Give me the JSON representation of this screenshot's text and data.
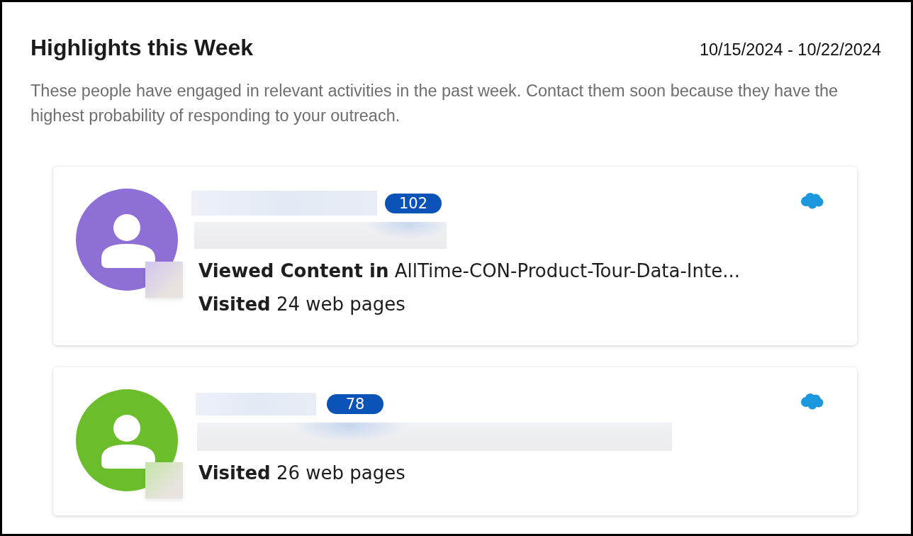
{
  "header": {
    "title": "Highlights this Week",
    "date_range": "10/15/2024 - 10/22/2024"
  },
  "description": "These people have engaged in relevant activities in the past week. Contact them soon because they have the highest probability of responding to your outreach.",
  "people": [
    {
      "color": "#8d6fd5",
      "score": "102",
      "activities": [
        "**Viewed Content in** AllTime-CON-Product-Tour-Data-Inte...",
        "**Visited** 24 web pages"
      ]
    },
    {
      "color": "#6bbd2b",
      "score": "78",
      "activities": [
        "**Visited** 26 web pages"
      ]
    }
  ]
}
